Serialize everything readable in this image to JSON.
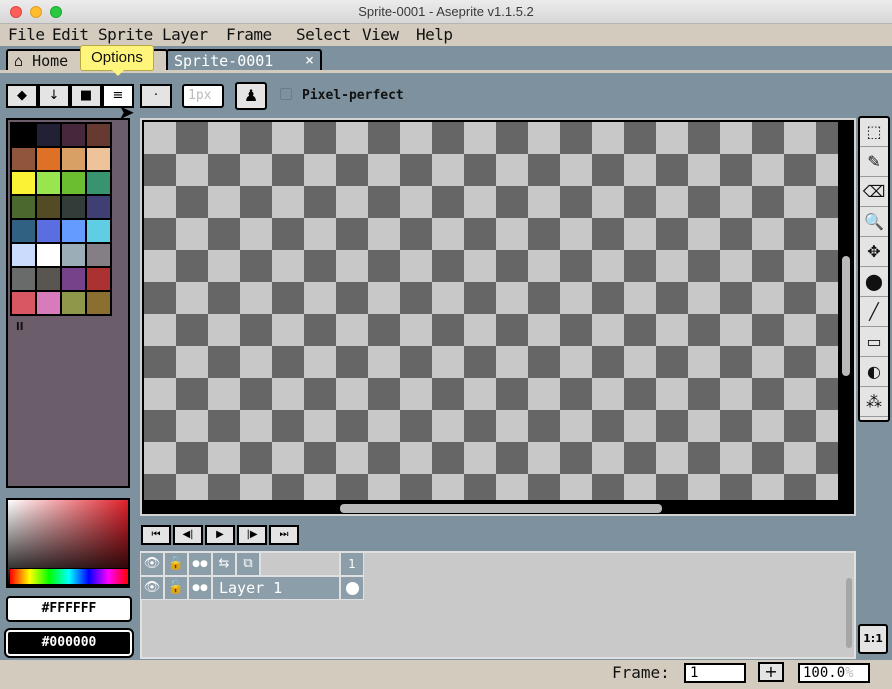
{
  "window": {
    "title": "Sprite-0001 - Aseprite v1.1.5.2"
  },
  "menu": [
    "File",
    "Edit",
    "Sprite",
    "Layer",
    "Frame",
    "Select",
    "View",
    "Help"
  ],
  "tabs": {
    "home": "Home",
    "sprite": "Sprite-0001",
    "close": "×"
  },
  "tooltip": "Options",
  "contextbar": {
    "segment_icons": [
      "◆",
      "↓",
      "■",
      "≡"
    ],
    "dot": "·",
    "brush_size": "1px",
    "ink_icon": "♟",
    "pixel_perfect_label": "Pixel-perfect"
  },
  "palette": {
    "colors": [
      "#000000",
      "#222034",
      "#45283c",
      "#663931",
      "#8f563b",
      "#df7126",
      "#d9a066",
      "#eec39a",
      "#fbf236",
      "#99e550",
      "#6abe30",
      "#37946e",
      "#4b692f",
      "#524b24",
      "#323c39",
      "#3f3f74",
      "#306082",
      "#5b6ee1",
      "#639bff",
      "#5fcde4",
      "#cbdbfc",
      "#ffffff",
      "#9badb7",
      "#847e87",
      "#696a6a",
      "#595652",
      "#76428a",
      "#ac3232",
      "#d95763",
      "#d77bba",
      "#8f974a",
      "#8a6f30"
    ],
    "handle": "ll"
  },
  "colors": {
    "foreground": "#FFFFFF",
    "background": "#000000"
  },
  "tools": [
    {
      "name": "rectangular-marquee-icon",
      "glyph": "⬚"
    },
    {
      "name": "pencil-icon",
      "glyph": "✎"
    },
    {
      "name": "eraser-icon",
      "glyph": "⌫"
    },
    {
      "name": "zoom-icon",
      "glyph": "🔍"
    },
    {
      "name": "move-icon",
      "glyph": "✥"
    },
    {
      "name": "paint-bucket-icon",
      "glyph": "⬤"
    },
    {
      "name": "line-icon",
      "glyph": "╱"
    },
    {
      "name": "rectangle-icon",
      "glyph": "▭"
    },
    {
      "name": "contour-icon",
      "glyph": "◐"
    },
    {
      "name": "spray-icon",
      "glyph": "⁂"
    }
  ],
  "zoom_reset_button": "1:1",
  "animation": [
    "⏮",
    "◀|",
    "▶",
    "|▶",
    "⏭"
  ],
  "timeline": {
    "header_icons": [
      "👁",
      "🔒",
      "●●",
      "⇆",
      "⧉"
    ],
    "layer_icons": [
      "👁",
      "🔓",
      "●●"
    ],
    "layer_name": "Layer 1",
    "frame_number": "1"
  },
  "status": {
    "frame_label": "Frame:",
    "frame_value": "1",
    "add": "+",
    "zoom": "100.0",
    "zoom_unit": "%"
  }
}
